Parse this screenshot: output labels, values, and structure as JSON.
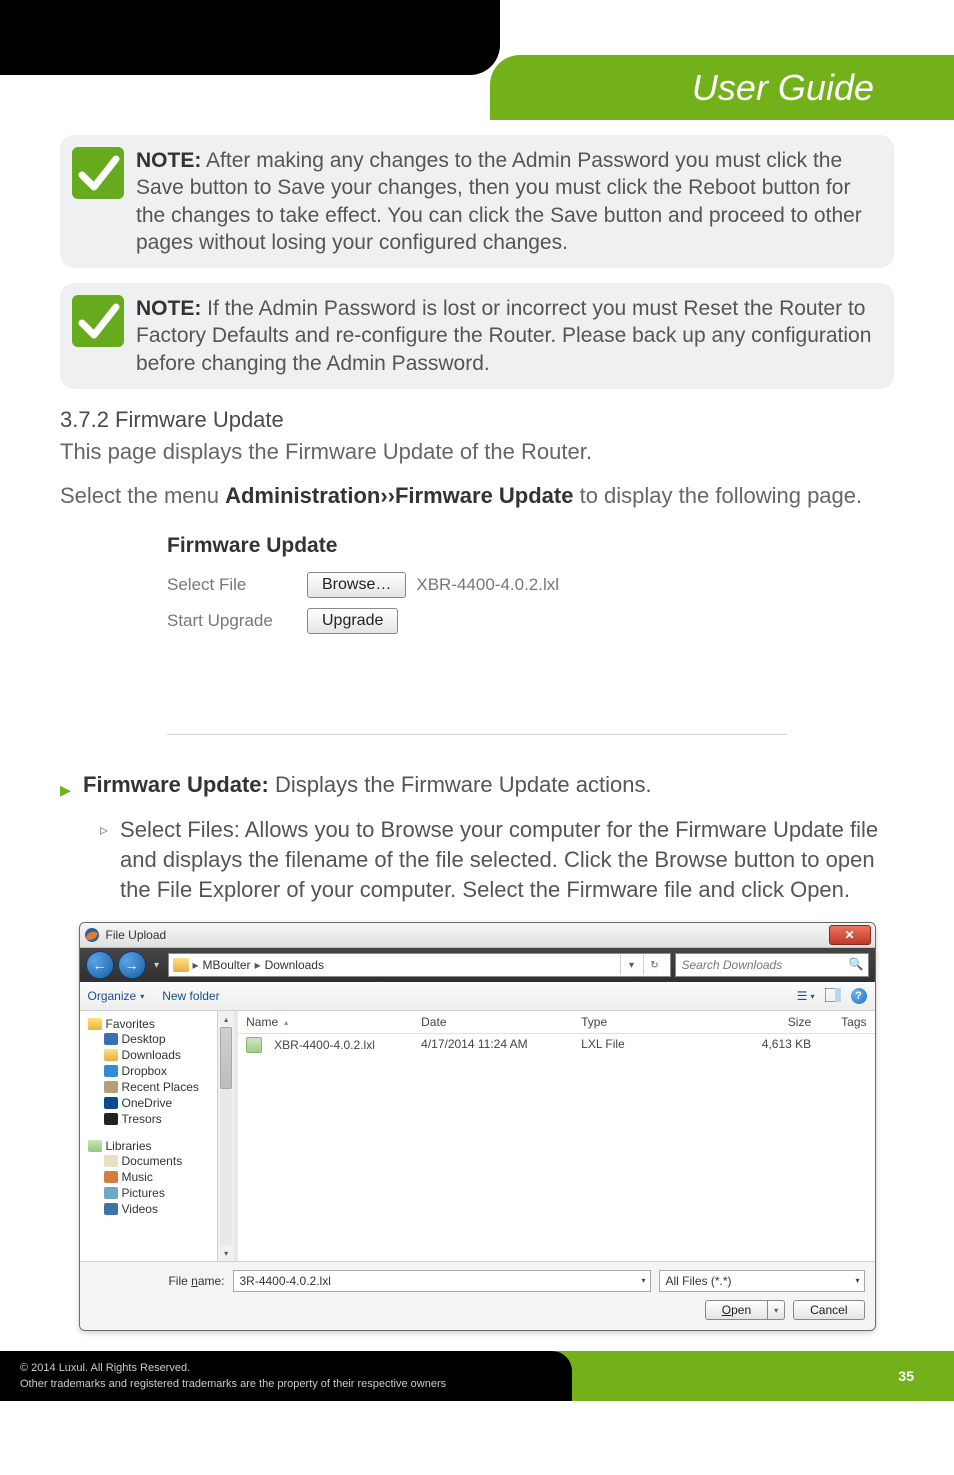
{
  "header": {
    "user_guide": "User Guide"
  },
  "notes": {
    "label": "NOTE:",
    "n1": "After making any changes to the Admin Password you must click the Save button to Save your changes, then you must click the Reboot button for the changes to take effect. You can click the Save button and proceed to other pages without losing your configured changes.",
    "n2": "If the Admin Password is lost or incorrect you must Reset the Router to Factory Defaults and re-configure the Router. Please back up any configuration before changing the Admin Password."
  },
  "sec": {
    "heading": "3.7.2 Firmware Update",
    "desc": "This page displays the Firmware Update of the Router.",
    "select_pre": "Select the menu ",
    "select_bold": "Administration››Firmware Update",
    "select_post": " to display the following page."
  },
  "fw": {
    "title": "Firmware Update",
    "select_file": "Select File",
    "browse": "Browse…",
    "fname": "XBR-4400-4.0.2.lxl",
    "start_upgrade": "Start Upgrade",
    "upgrade": "Upgrade"
  },
  "bullets": {
    "b1_strong": "Firmware Update:",
    "b1_text": " Displays the Firmware Update actions.",
    "b2_strong": "Select Files:",
    "b2_text": " Allows you to Browse your computer for the Firmware Update file and displays the filename of the file selected. Click the Browse button to open the File Explorer of your computer. Select the Firmware file and click Open."
  },
  "dialog": {
    "title": "File Upload",
    "path1": "MBoulter",
    "path2": "Downloads",
    "search_ph": "Search Downloads",
    "organize": "Organize",
    "newfolder": "New folder",
    "cols": {
      "name": "Name",
      "date": "Date",
      "type": "Type",
      "size": "Size",
      "tags": "Tags"
    },
    "side": {
      "favorites": "Favorites",
      "desktop": "Desktop",
      "downloads": "Downloads",
      "dropbox": "Dropbox",
      "recent": "Recent Places",
      "onedrive": "OneDrive",
      "tresors": "Tresors",
      "libraries": "Libraries",
      "documents": "Documents",
      "music": "Music",
      "pictures": "Pictures",
      "videos": "Videos"
    },
    "row": {
      "name": "XBR-4400-4.0.2.lxl",
      "date": "4/17/2014 11:24 AM",
      "type": "LXL File",
      "size": "4,613 KB"
    },
    "fname_label_pre": "File ",
    "fname_label_u": "n",
    "fname_label_post": "ame:",
    "fname_value": "3R-4400-4.0.2.lxl",
    "types": "All Files (*.*)",
    "open_pre": "",
    "open_u": "O",
    "open_post": "pen",
    "cancel": "Cancel"
  },
  "footer": {
    "line1": "© 2014  Luxul. All Rights Reserved.",
    "line2": "Other trademarks and registered trademarks are the property of their respective owners",
    "page": "35"
  }
}
